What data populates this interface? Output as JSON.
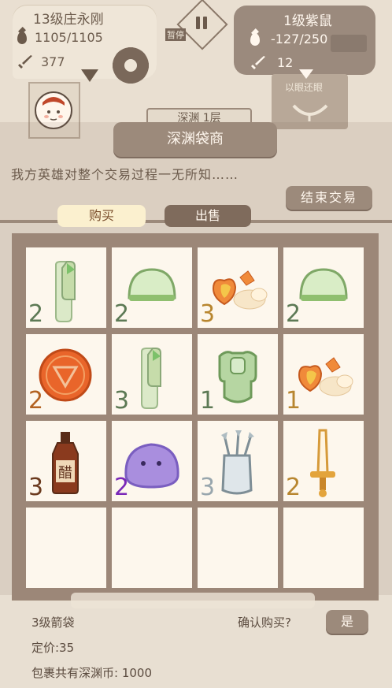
{
  "hero": {
    "name": "13级庄永刚",
    "hp": "1105/1105",
    "atk": "377"
  },
  "pause": {
    "label": "暂停"
  },
  "enemy": {
    "name": "1级紫鼠",
    "hp": "-127/250",
    "atk": "12",
    "portrait_label": "以眼还眼"
  },
  "behind_banner": "深渊 1层",
  "shop": {
    "title": "深渊袋商",
    "message": "我方英雄对整个交易过程一无所知……",
    "end_button": "结束交易",
    "tabs": {
      "buy": "购买",
      "sell": "出售"
    }
  },
  "grid": [
    {
      "icon": "bamboo-sprout-icon",
      "qty": "2",
      "qty_color": "#5d7a55"
    },
    {
      "icon": "green-bun-icon",
      "qty": "2",
      "qty_color": "#5d7a55"
    },
    {
      "icon": "heart-fruit-icon",
      "qty": "3",
      "qty_color": "#b8862f"
    },
    {
      "icon": "green-bun-icon",
      "qty": "2",
      "qty_color": "#5d7a55"
    },
    {
      "icon": "orange-token-icon",
      "qty": "2",
      "qty_color": "#b36221"
    },
    {
      "icon": "bamboo-sprout-icon",
      "qty": "3",
      "qty_color": "#5d7a55"
    },
    {
      "icon": "green-armor-icon",
      "qty": "1",
      "qty_color": "#5d7a55"
    },
    {
      "icon": "heart-fruit-icon",
      "qty": "1",
      "qty_color": "#b8862f"
    },
    {
      "icon": "vinegar-bottle-icon",
      "qty": "3",
      "qty_color": "#6b3a1e"
    },
    {
      "icon": "purple-slime-icon",
      "qty": "2",
      "qty_color": "#7a28b8"
    },
    {
      "icon": "quiver-icon",
      "qty": "3",
      "qty_color": "#98a6ad"
    },
    {
      "icon": "short-sword-icon",
      "qty": "2",
      "qty_color": "#b8862f"
    },
    {
      "icon": "",
      "qty": "",
      "qty_color": ""
    },
    {
      "icon": "",
      "qty": "",
      "qty_color": ""
    },
    {
      "icon": "",
      "qty": "",
      "qty_color": ""
    },
    {
      "icon": "",
      "qty": "",
      "qty_color": ""
    }
  ],
  "footer": {
    "item_name": "3级箭袋",
    "price": "定价:35",
    "coins": "包裹共有深渊币: 1000",
    "confirm_question": "确认购买?",
    "yes_button": "是"
  },
  "bottle_label": "醋",
  "colors": {
    "brown": "#9c8a7b",
    "cream": "#fdf7ed",
    "text": "#6b5a4b"
  }
}
